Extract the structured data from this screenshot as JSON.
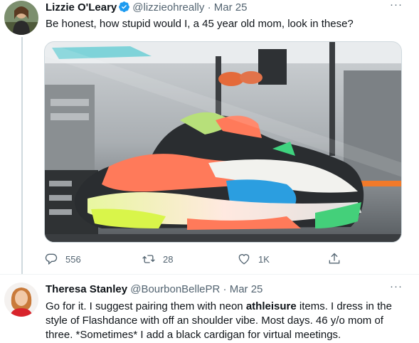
{
  "tweet1": {
    "name": "Lizzie O'Leary",
    "handle": "@lizzieohreally",
    "dot": "·",
    "date": "Mar 25",
    "text": "Be honest, how stupid would I, a 45 year old mom, look in these?",
    "actions": {
      "reply_count": "556",
      "retweet_count": "28",
      "like_count": "1K"
    }
  },
  "tweet2": {
    "name": "Theresa Stanley",
    "handle": "@BourbonBellePR",
    "dot": "·",
    "date": "Mar 25",
    "text_before": "Go for it. I suggest pairing them with neon ",
    "text_bold": "athleisure",
    "text_after": " items. I dress in the style of Flashdance with off an shoulder vibe. Most days. 46 y/o mom of three. *Sometimes* I add a black cardigan for virtual meetings."
  },
  "more_label": "···",
  "colors": {
    "verified": "#1d9bf0",
    "secondary_text": "#536471",
    "primary_text": "#0f1419"
  },
  "icons": [
    "verified-badge-icon",
    "more-icon",
    "reply-icon",
    "retweet-icon",
    "like-icon",
    "share-icon"
  ]
}
